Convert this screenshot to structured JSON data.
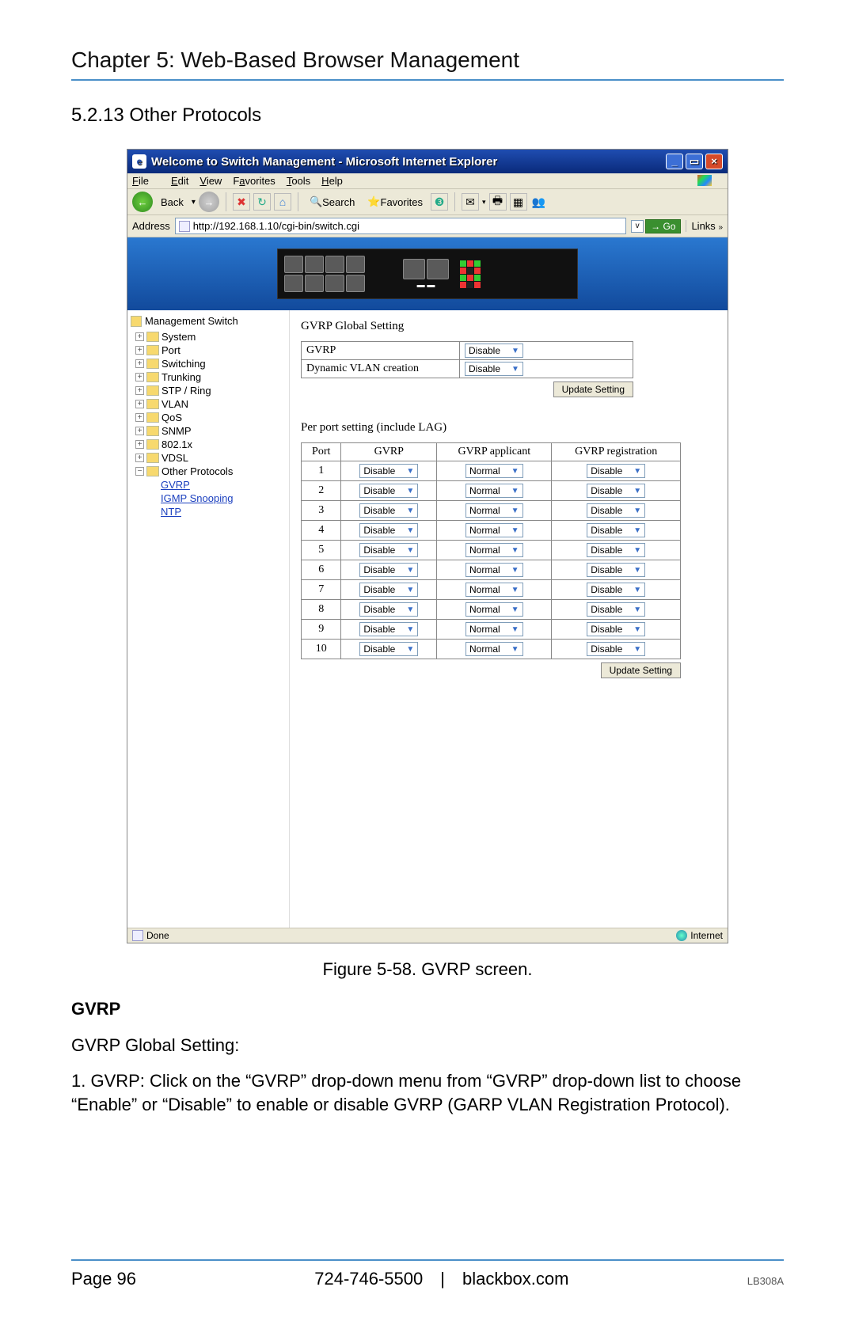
{
  "doc": {
    "chapter_title": "Chapter 5: Web-Based Browser Management",
    "section_title": "5.2.13 Other Protocols",
    "figure_caption": "Figure 5-58. GVRP screen.",
    "gvrp_heading": "GVRP",
    "gvrp_sub": "GVRP Global Setting:",
    "gvrp_item1": "1. GVRP: Click on the “GVRP” drop-down menu from “GVRP” drop-down list to choose “Enable” or “Disable” to enable or disable GVRP (GARP VLAN Registration Protocol).",
    "footer_page": "Page 96",
    "footer_center": "724-746-5500 | blackbox.com",
    "footer_code": "LB308A"
  },
  "ie": {
    "title": "Welcome to Switch Management - Microsoft Internet Explorer",
    "menus": [
      "File",
      "Edit",
      "View",
      "Favorites",
      "Tools",
      "Help"
    ],
    "toolbar": {
      "back": "Back",
      "search": "Search",
      "favorites": "Favorites"
    },
    "address_label": "Address",
    "address_value": "http://192.168.1.10/cgi-bin/switch.cgi",
    "go": "Go",
    "links": "Links",
    "status_done": "Done",
    "status_zone": "Internet"
  },
  "tree": {
    "root": "Management Switch",
    "items": [
      "System",
      "Port",
      "Switching",
      "Trunking",
      "STP / Ring",
      "VLAN",
      "QoS",
      "SNMP",
      "802.1x",
      "VDSL",
      "Other Protocols"
    ],
    "sub": [
      "GVRP",
      "IGMP Snooping",
      "NTP"
    ]
  },
  "content": {
    "global_header": "GVRP Global Setting",
    "row_gvrp": "GVRP",
    "row_dvlan": "Dynamic VLAN creation",
    "disable": "Disable",
    "update": "Update Setting",
    "perport_header": "Per port setting (include LAG)",
    "cols": [
      "Port",
      "GVRP",
      "GVRP  applicant",
      "GVRP  registration"
    ],
    "ports": [
      {
        "n": "1",
        "g": "Disable",
        "a": "Normal",
        "r": "Disable"
      },
      {
        "n": "2",
        "g": "Disable",
        "a": "Normal",
        "r": "Disable"
      },
      {
        "n": "3",
        "g": "Disable",
        "a": "Normal",
        "r": "Disable"
      },
      {
        "n": "4",
        "g": "Disable",
        "a": "Normal",
        "r": "Disable"
      },
      {
        "n": "5",
        "g": "Disable",
        "a": "Normal",
        "r": "Disable"
      },
      {
        "n": "6",
        "g": "Disable",
        "a": "Normal",
        "r": "Disable"
      },
      {
        "n": "7",
        "g": "Disable",
        "a": "Normal",
        "r": "Disable"
      },
      {
        "n": "8",
        "g": "Disable",
        "a": "Normal",
        "r": "Disable"
      },
      {
        "n": "9",
        "g": "Disable",
        "a": "Normal",
        "r": "Disable"
      },
      {
        "n": "10",
        "g": "Disable",
        "a": "Normal",
        "r": "Disable"
      }
    ]
  }
}
